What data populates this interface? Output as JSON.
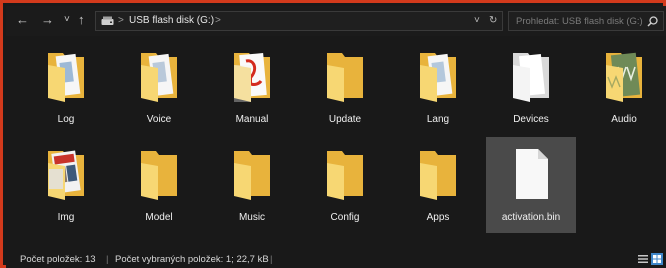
{
  "nav": {
    "back_glyph": "←",
    "forward_glyph": "→",
    "recent_glyph": "˅",
    "up_glyph": "↑"
  },
  "address": {
    "sep1": ">",
    "location": "USB flash disk (G:)",
    "sep2": ">",
    "dropdown_glyph": "˅",
    "refresh_glyph": "↻"
  },
  "search": {
    "placeholder": "Prohledat: USB flash disk (G:)",
    "icon": "search-icon"
  },
  "items": [
    {
      "label": "Log",
      "kind": "folder-document"
    },
    {
      "label": "Voice",
      "kind": "folder-document"
    },
    {
      "label": "Manual",
      "kind": "folder-pdf"
    },
    {
      "label": "Update",
      "kind": "folder"
    },
    {
      "label": "Lang",
      "kind": "folder-document"
    },
    {
      "label": "Devices",
      "kind": "folder-white"
    },
    {
      "label": "Audio",
      "kind": "folder-audio"
    },
    {
      "label": "Img",
      "kind": "folder-images"
    },
    {
      "label": "Model",
      "kind": "folder"
    },
    {
      "label": "Music",
      "kind": "folder"
    },
    {
      "label": "Config",
      "kind": "folder"
    },
    {
      "label": "Apps",
      "kind": "folder"
    },
    {
      "label": "activation.bin",
      "kind": "file",
      "selected": true
    }
  ],
  "status": {
    "count": "Počet položek: 13",
    "divider": "|",
    "selected": "Počet vybraných položek: 1; 22,7 kB",
    "divider2": "|"
  },
  "colors": {
    "frame_border": "#d33a1c",
    "background": "#191919",
    "folder_back": "#e8b33c",
    "folder_front": "#f7d773",
    "selection": "#4a4a4a",
    "view_active": "#3f86c8"
  }
}
